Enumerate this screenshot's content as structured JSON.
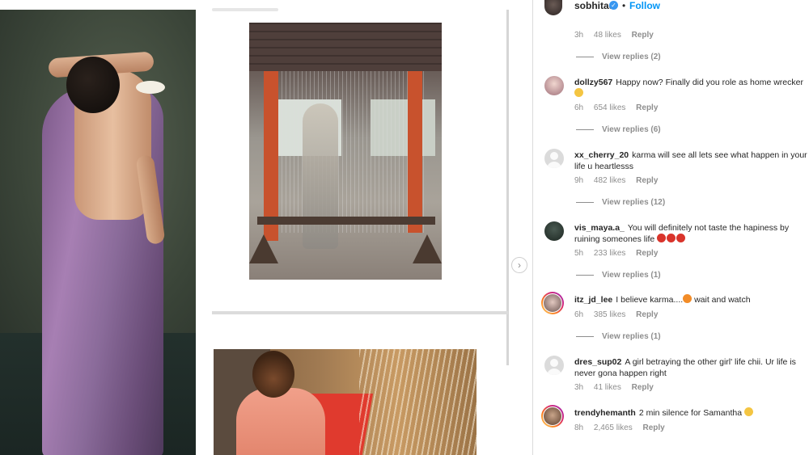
{
  "header": {
    "username": "sobhitad",
    "separator": "•",
    "follow_label": "Follow"
  },
  "icons": {
    "verified": "verified-badge-icon",
    "carousel_next": "chevron-right-icon",
    "default_avatar": "default-user-avatar-icon"
  },
  "colors": {
    "follow_blue": "#0095f6",
    "verified_blue": "#3897f0",
    "meta_gray": "#8e8e8e"
  },
  "comments": [
    {
      "username": "",
      "text": "",
      "time": "3h",
      "likes": "48 likes",
      "reply_label": "Reply",
      "view_replies": "View replies (2)"
    },
    {
      "username": "dollzy567",
      "text": "Happy now? Finally did you role as home wrecker",
      "emoji": "👍",
      "time": "6h",
      "likes": "654 likes",
      "reply_label": "Reply",
      "view_replies": "View replies (6)"
    },
    {
      "username": "xx_cherry_20",
      "text": "karma will see all lets see what happen in your life u heartlesss",
      "time": "9h",
      "likes": "482 likes",
      "reply_label": "Reply",
      "view_replies": "View replies (12)"
    },
    {
      "username": "vis_maya.a_",
      "text": "You will definitely not taste the hapiness by ruining someones life",
      "emoji": "😡😡😡",
      "time": "5h",
      "likes": "233 likes",
      "reply_label": "Reply",
      "view_replies": "View replies (1)"
    },
    {
      "username": "itz_jd_lee",
      "text": "I believe karma....",
      "emoji": "🔥",
      "text_after": "wait and watch",
      "time": "6h",
      "likes": "385 likes",
      "reply_label": "Reply",
      "view_replies": "View replies (1)"
    },
    {
      "username": "dres_sup02",
      "text": "A girl betraying the other girl' life chii. Ur life is never gona happen right",
      "time": "3h",
      "likes": "41 likes",
      "reply_label": "Reply"
    },
    {
      "username": "trendyhemanth",
      "text": "2 min silence for Samantha",
      "emoji": "😢",
      "time": "8h",
      "likes": "2,465 likes",
      "reply_label": "Reply"
    }
  ]
}
